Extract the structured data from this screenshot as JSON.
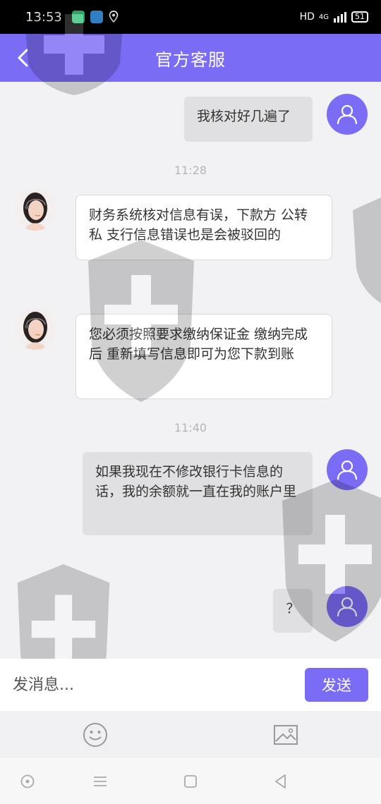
{
  "status_bar": {
    "time": "13:53",
    "network": "HD",
    "signal": "4G",
    "battery": "51"
  },
  "header": {
    "title": "官方客服",
    "back_icon": "chevron-left-icon"
  },
  "messages": [
    {
      "sender": "user",
      "text": "我核对好几遍了"
    },
    {
      "type": "timestamp",
      "text": "11:28"
    },
    {
      "sender": "agent",
      "text": "财务系统核对信息有误，下款方 公转私  支行信息错误也是会被驳回的"
    },
    {
      "sender": "agent",
      "text": "您必须按照要求缴纳保证金 缴纳完成后 重新填写信息即可为您下款到账"
    },
    {
      "type": "timestamp",
      "text": "11:40"
    },
    {
      "sender": "user",
      "text": "如果我现在不修改银行卡信息的话，我的余额就一直在我的账户里"
    },
    {
      "sender": "user",
      "text": "？"
    }
  ],
  "input_bar": {
    "placeholder": "发消息...",
    "send_label": "发送"
  },
  "tool_bar": {
    "emoji_icon": "emoji-icon",
    "image_icon": "image-icon"
  },
  "nav_bar": {
    "items": [
      "assistant-icon",
      "menu-icon",
      "home-icon",
      "back-icon"
    ]
  },
  "colors": {
    "accent": "#7b6cf6",
    "chat_bg": "#f2f2f4",
    "user_bubble": "#e0e0e2",
    "agent_bubble": "#ffffff"
  }
}
